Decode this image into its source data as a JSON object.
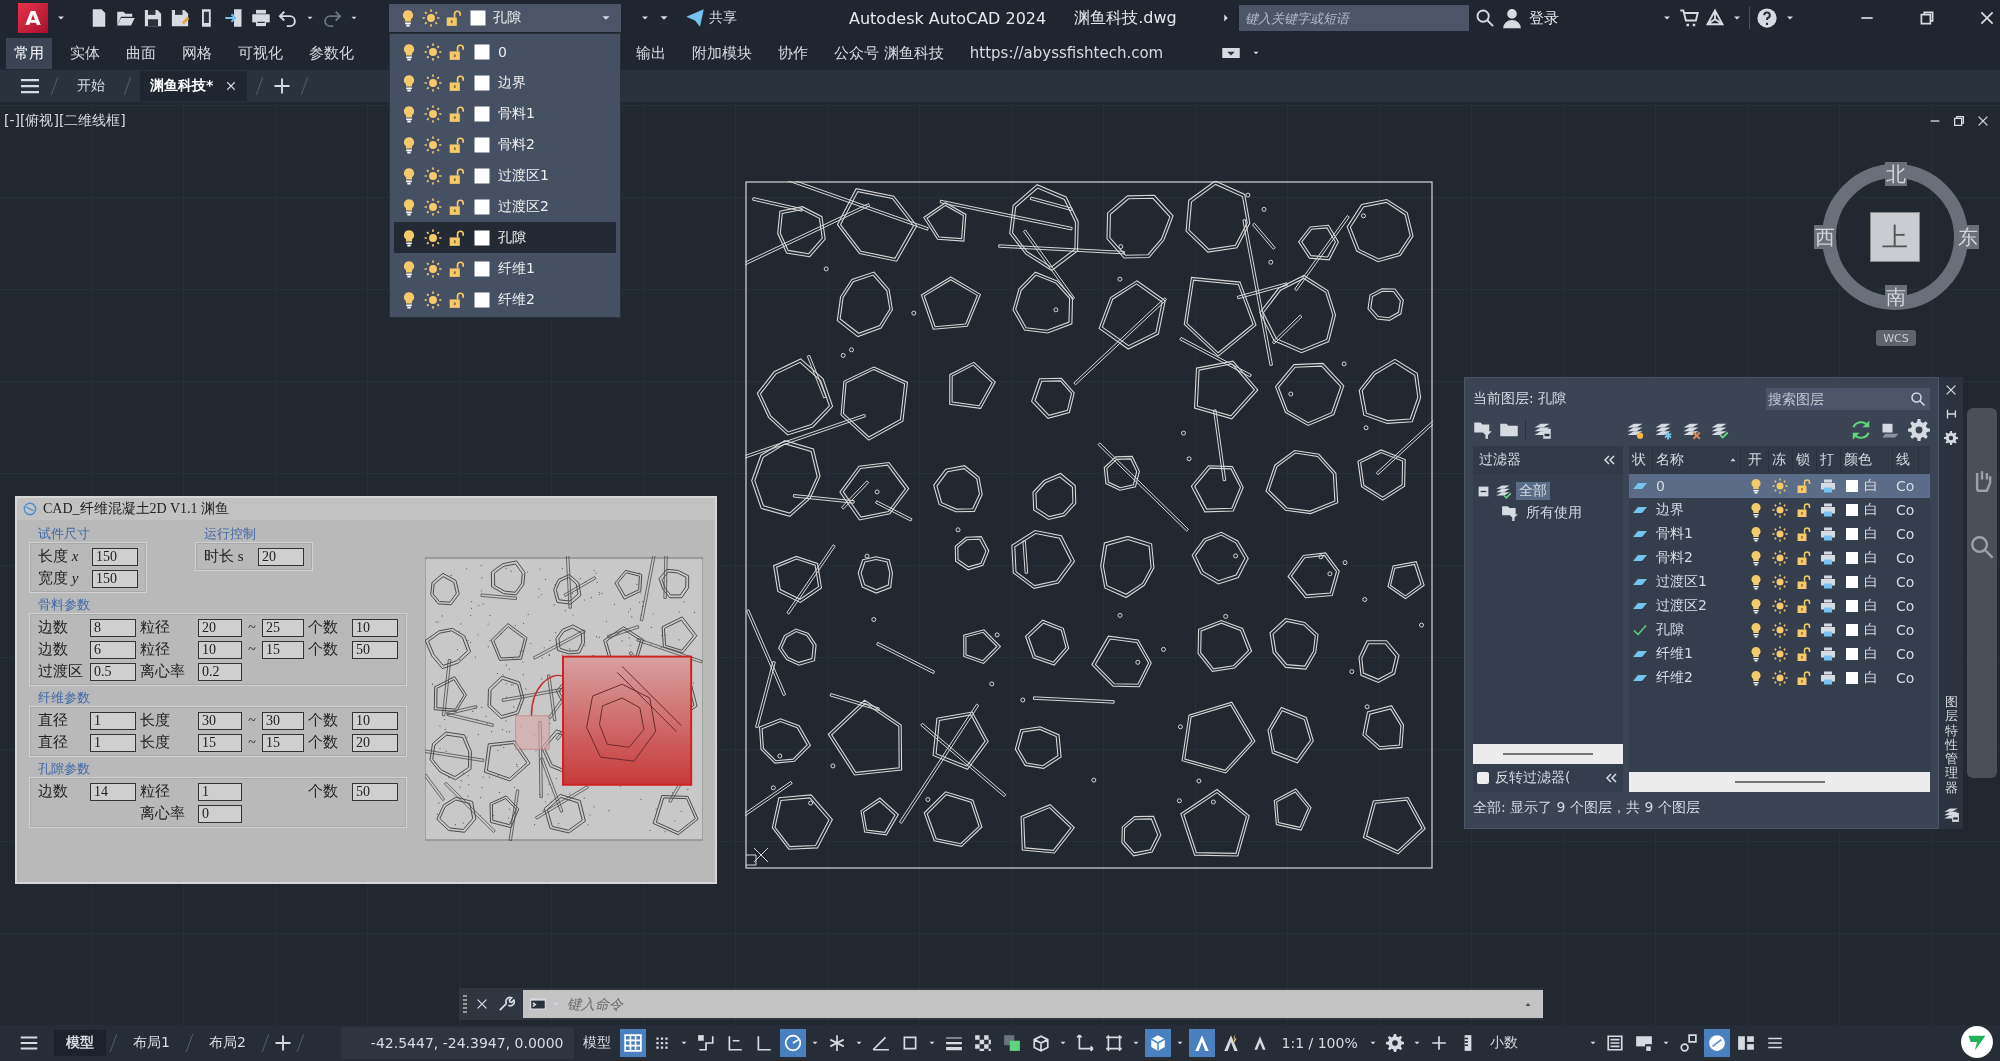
{
  "title_bar": {
    "app_letter": "A",
    "layer_combo": {
      "value": "孔隙",
      "on": true,
      "frozen": false,
      "locked": false
    },
    "share": "共享",
    "title": "Autodesk AutoCAD 2024",
    "file": "渊鱼科技.dwg",
    "search": {
      "placeholder": "键入关键字或短语"
    },
    "login": "登录"
  },
  "ribbon_tabs": [
    {
      "label": "常用",
      "selected": true
    },
    {
      "label": "实体",
      "selected": false
    },
    {
      "label": "曲面",
      "selected": false
    },
    {
      "label": "网格",
      "selected": false
    },
    {
      "label": "可视化",
      "selected": false
    },
    {
      "label": "参数化",
      "selected": false
    },
    {
      "label": "输出",
      "selected": false
    },
    {
      "label": "附加模块",
      "selected": false
    },
    {
      "label": "协作",
      "selected": false
    },
    {
      "label": "公众号 渊鱼科技",
      "selected": false
    },
    {
      "label": "https://abyssfishtech.com",
      "selected": false
    }
  ],
  "doc_tabs": [
    {
      "label": "开始",
      "selected": false,
      "closable": false
    },
    {
      "label": "渊鱼科技*",
      "selected": true,
      "closable": true
    }
  ],
  "layer_dropdown": {
    "items": [
      {
        "name": "0",
        "selected": false,
        "on": true,
        "frozen": false,
        "locked": false
      },
      {
        "name": "边界",
        "selected": false,
        "on": true,
        "frozen": false,
        "locked": false
      },
      {
        "name": "骨料1",
        "selected": false,
        "on": true,
        "frozen": false,
        "locked": false
      },
      {
        "name": "骨料2",
        "selected": false,
        "on": true,
        "frozen": false,
        "locked": false
      },
      {
        "name": "过渡区1",
        "selected": false,
        "on": true,
        "frozen": false,
        "locked": false
      },
      {
        "name": "过渡区2",
        "selected": false,
        "on": true,
        "frozen": false,
        "locked": false
      },
      {
        "name": "孔隙",
        "selected": true,
        "on": true,
        "frozen": false,
        "locked": false
      },
      {
        "name": "纤维1",
        "selected": false,
        "on": true,
        "frozen": false,
        "locked": false
      },
      {
        "name": "纤维2",
        "selected": false,
        "on": true,
        "frozen": false,
        "locked": false
      }
    ]
  },
  "viewport": {
    "label": "[-][俯视][二维线框]",
    "viewcube": {
      "north": "北",
      "west": "西",
      "top": "上",
      "east": "东",
      "south": "南",
      "ucs": "WCS"
    }
  },
  "dialog": {
    "title": "CAD_纤维混凝土2D V1.1 渊鱼",
    "top_groups": [
      {
        "title": "试件尺寸",
        "rows": [
          [
            {
              "label": "长度 *x*",
              "value": "150"
            }
          ],
          [
            {
              "label": "宽度 *y*",
              "value": "150"
            }
          ]
        ]
      },
      {
        "title": "运行控制",
        "rows": [
          [
            {
              "label": "时长 s",
              "value": "20"
            }
          ]
        ]
      }
    ],
    "groups": [
      {
        "title": "骨料参数",
        "rows": [
          [
            {
              "label": "边数",
              "value": "8"
            },
            {
              "label": "粒径",
              "value": "20",
              "sep": "~",
              "value_to": "25"
            },
            {
              "label": "个数",
              "value": "10"
            }
          ],
          [
            {
              "label": "边数",
              "value": "6"
            },
            {
              "label": "粒径",
              "value": "10",
              "sep": "~",
              "value_to": "15"
            },
            {
              "label": "个数",
              "value": "50"
            }
          ],
          [
            {
              "label": "过渡区",
              "value": "0.5"
            },
            {
              "label": "离心率",
              "value": "0.2"
            },
            null
          ]
        ]
      },
      {
        "title": "纤维参数",
        "rows": [
          [
            {
              "label": "直径",
              "value": "1"
            },
            {
              "label": "长度",
              "value": "30",
              "sep": "~",
              "value_to": "30"
            },
            {
              "label": "个数",
              "value": "10"
            }
          ],
          [
            {
              "label": "直径",
              "value": "1"
            },
            {
              "label": "长度",
              "value": "15",
              "sep": "~",
              "value_to": "15"
            },
            {
              "label": "个数",
              "value": "20"
            }
          ]
        ]
      },
      {
        "title": "孔隙参数",
        "rows": [
          [
            {
              "label": "边数",
              "value": "14"
            },
            {
              "label": "粒径",
              "value": "1"
            },
            {
              "label": "个数",
              "value": "50"
            }
          ],
          [
            null,
            {
              "label": "离心率",
              "value": "0"
            },
            null
          ]
        ]
      }
    ]
  },
  "layer_panel": {
    "current_label": "当前图层: 孔隙",
    "search": {
      "placeholder": "搜索图层"
    },
    "filters_title": "过滤器",
    "filters": [
      {
        "label": "全部",
        "selected": true,
        "expanded": true,
        "children": [
          {
            "label": "所有使用",
            "selected": false
          }
        ]
      }
    ],
    "columns": [
      "状",
      "名称",
      "开",
      "冻",
      "锁",
      "打",
      "颜色",
      "线"
    ],
    "layers": [
      {
        "name": "0",
        "current": false,
        "selected": true,
        "on": true,
        "frozen": false,
        "locked": false,
        "plot": true,
        "color_name": "白",
        "linetype": "Co"
      },
      {
        "name": "边界",
        "current": false,
        "selected": false,
        "on": true,
        "frozen": false,
        "locked": false,
        "plot": true,
        "color_name": "白",
        "linetype": "Co"
      },
      {
        "name": "骨料1",
        "current": false,
        "selected": false,
        "on": true,
        "frozen": false,
        "locked": false,
        "plot": true,
        "color_name": "白",
        "linetype": "Co"
      },
      {
        "name": "骨料2",
        "current": false,
        "selected": false,
        "on": true,
        "frozen": false,
        "locked": false,
        "plot": true,
        "color_name": "白",
        "linetype": "Co"
      },
      {
        "name": "过渡区1",
        "current": false,
        "selected": false,
        "on": true,
        "frozen": false,
        "locked": false,
        "plot": true,
        "color_name": "白",
        "linetype": "Co"
      },
      {
        "name": "过渡区2",
        "current": false,
        "selected": false,
        "on": true,
        "frozen": false,
        "locked": false,
        "plot": true,
        "color_name": "白",
        "linetype": "Co"
      },
      {
        "name": "孔隙",
        "current": true,
        "selected": false,
        "on": true,
        "frozen": false,
        "locked": false,
        "plot": true,
        "color_name": "白",
        "linetype": "Co"
      },
      {
        "name": "纤维1",
        "current": false,
        "selected": false,
        "on": true,
        "frozen": false,
        "locked": false,
        "plot": true,
        "color_name": "白",
        "linetype": "Co"
      },
      {
        "name": "纤维2",
        "current": false,
        "selected": false,
        "on": true,
        "frozen": false,
        "locked": false,
        "plot": true,
        "color_name": "白",
        "linetype": "Co"
      }
    ],
    "invert_filter": {
      "label": "反转过滤器(",
      "checked": false
    },
    "status": "全部: 显示了 9 个图层，共 9 个图层",
    "side_title": "图层特性管理器"
  },
  "command_line": {
    "placeholder": "键入命令"
  },
  "status_bar": {
    "layout_tabs": [
      {
        "label": "模型",
        "selected": true
      },
      {
        "label": "布局1",
        "selected": false
      },
      {
        "label": "布局2",
        "selected": false
      }
    ],
    "coordinates": "-42.5447, -24.3947, 0.0000",
    "space": "模型",
    "tools": [
      {
        "kind": "grid",
        "on": true
      },
      {
        "kind": "dots",
        "on": false
      },
      {
        "kind": "caret",
        "on": false
      },
      {
        "kind": "steps",
        "on": false
      },
      {
        "kind": "corner-ruler",
        "on": false
      },
      {
        "kind": "corner",
        "on": false
      },
      {
        "kind": "target",
        "on": true
      },
      {
        "kind": "caret",
        "on": false
      },
      {
        "kind": "asterisk",
        "on": false
      },
      {
        "kind": "caret",
        "on": false
      },
      {
        "kind": "angle",
        "on": false
      },
      {
        "kind": "square",
        "on": false
      },
      {
        "kind": "caret",
        "on": false
      },
      {
        "kind": "lines",
        "on": false
      },
      {
        "kind": "checker",
        "on": false
      },
      {
        "kind": "squares",
        "on": false
      },
      {
        "kind": "cube",
        "on": false
      },
      {
        "kind": "caret",
        "on": false
      },
      {
        "kind": "axes",
        "on": false
      },
      {
        "kind": "frame",
        "on": false
      },
      {
        "kind": "caret",
        "on": false
      },
      {
        "kind": "hexagon",
        "on": true
      },
      {
        "kind": "caret",
        "on": false
      },
      {
        "kind": "a-shape",
        "on": true
      },
      {
        "kind": "a-bolt",
        "on": false
      },
      {
        "kind": "a-small",
        "on": false
      }
    ],
    "annotation_scale": "1:1 / 100%",
    "tools2": [
      {
        "kind": "caret",
        "on": false
      },
      {
        "kind": "gear",
        "on": false
      },
      {
        "kind": "caret",
        "on": false
      },
      {
        "kind": "plus",
        "on": false
      },
      {
        "kind": "ruler",
        "on": false
      }
    ],
    "units": "小数",
    "tools3": [
      {
        "kind": "caret",
        "on": false
      },
      {
        "kind": "list",
        "on": false
      },
      {
        "kind": "window-lock",
        "on": false
      },
      {
        "kind": "caret",
        "on": false
      },
      {
        "kind": "shapes",
        "on": false
      },
      {
        "kind": "disk",
        "on": true
      },
      {
        "kind": "panels",
        "on": false
      },
      {
        "kind": "menu",
        "on": false
      }
    ]
  }
}
